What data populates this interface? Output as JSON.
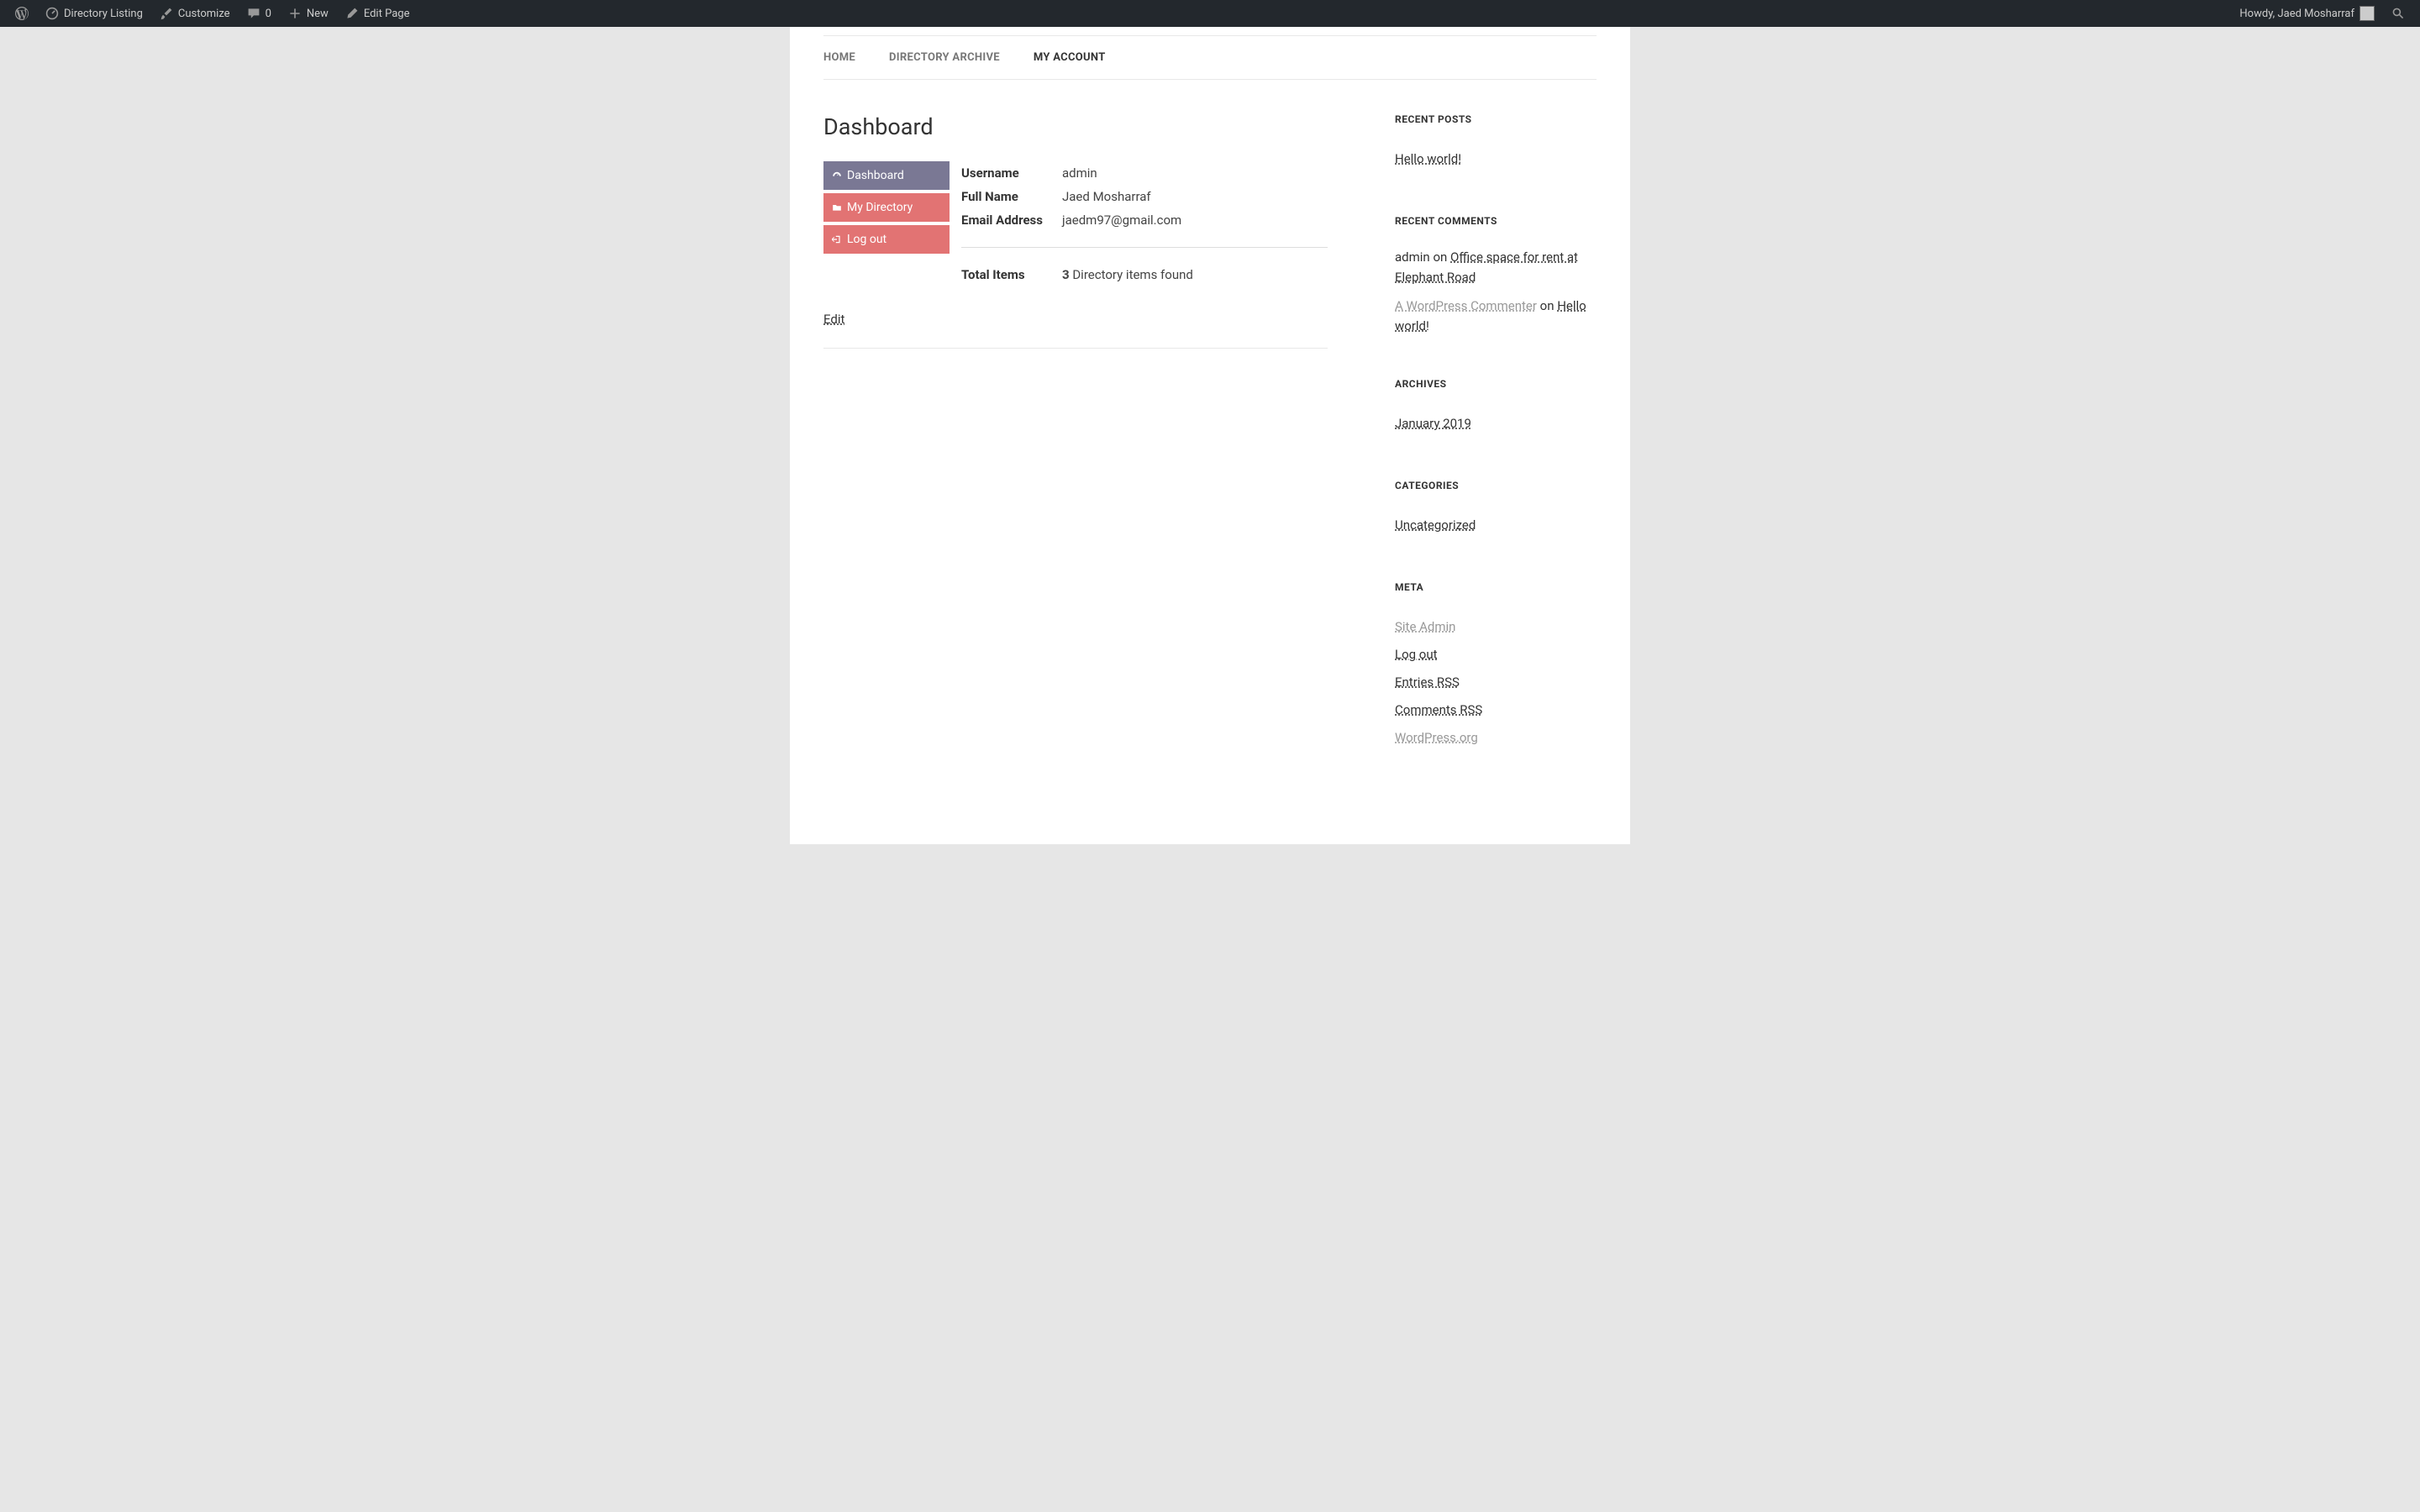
{
  "adminbar": {
    "site_name": "Directory Listing",
    "customize": "Customize",
    "comments_count": "0",
    "new": "New",
    "edit_page": "Edit Page",
    "howdy": "Howdy, Jaed Mosharraf"
  },
  "nav": {
    "home": "HOME",
    "archive": "DIRECTORY ARCHIVE",
    "account": "MY ACCOUNT"
  },
  "page": {
    "title": "Dashboard",
    "edit_label": "Edit"
  },
  "dashnav": {
    "dashboard": "Dashboard",
    "my_directory": "My Directory",
    "logout": "Log out"
  },
  "userinfo": {
    "username_label": "Username",
    "username_value": "admin",
    "fullname_label": "Full Name",
    "fullname_value": "Jaed Mosharraf",
    "email_label": "Email Address",
    "email_value": "jaedm97@gmail.com",
    "total_label": "Total Items",
    "total_count": "3",
    "total_suffix": " Directory items found"
  },
  "widgets": {
    "recent_posts": {
      "title": "RECENT POSTS",
      "items": [
        "Hello world!"
      ]
    },
    "recent_comments": {
      "title": "RECENT COMMENTS",
      "items": [
        {
          "author": "admin",
          "on": " on ",
          "post": "Office space for rent at Ele­phant Road",
          "author_link": false
        },
        {
          "author": "A WordPress Commenter",
          "on": " on ",
          "post": "Hello world!",
          "author_link": true
        }
      ]
    },
    "archives": {
      "title": "ARCHIVES",
      "items": [
        "January 2019"
      ]
    },
    "categories": {
      "title": "CATEGORIES",
      "items": [
        "Uncategorized"
      ]
    },
    "meta": {
      "title": "META",
      "items": [
        {
          "label": "Site Admin",
          "fade": true
        },
        {
          "label": "Log out",
          "fade": false
        },
        {
          "label": "Entries RSS",
          "fade": false
        },
        {
          "label": "Comments RSS",
          "fade": false
        },
        {
          "label": "WordPress.org",
          "fade": true
        }
      ]
    }
  }
}
